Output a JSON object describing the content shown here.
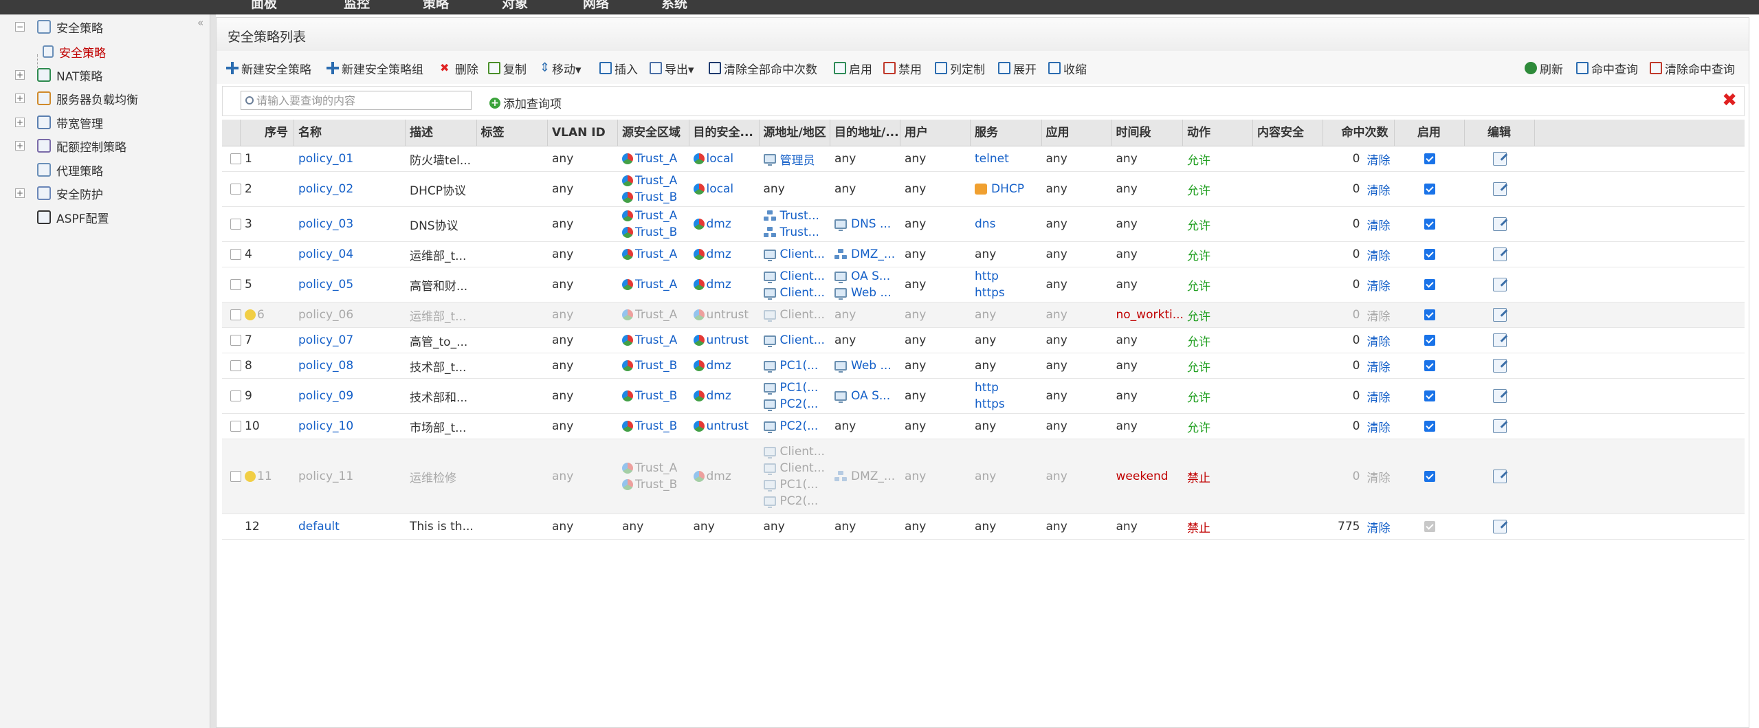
{
  "topnav": {
    "items": [
      "面板",
      "监控",
      "策略",
      "对象",
      "网络",
      "系统"
    ]
  },
  "sidebar": {
    "collapse_icon": "«",
    "items": [
      {
        "label": "安全策略",
        "toggle": "−",
        "icon": "policy-icon"
      },
      {
        "label": "安全策略",
        "selected": true,
        "icon": "policy-icon"
      },
      {
        "label": "NAT策略",
        "toggle": "+",
        "icon": "nat-icon"
      },
      {
        "label": "服务器负载均衡",
        "toggle": "+",
        "icon": "server-lb-icon"
      },
      {
        "label": "带宽管理",
        "toggle": "+",
        "icon": "bandwidth-icon"
      },
      {
        "label": "配额控制策略",
        "toggle": "+",
        "icon": "quota-icon"
      },
      {
        "label": "代理策略",
        "icon": "proxy-icon"
      },
      {
        "label": "安全防护",
        "toggle": "+",
        "icon": "shield-icon"
      },
      {
        "label": "ASPF配置",
        "icon": "aspf-icon"
      }
    ]
  },
  "panel": {
    "title": "安全策略列表"
  },
  "toolbar": {
    "new_policy": "新建安全策略",
    "new_group": "新建安全策略组",
    "delete": "删除",
    "copy": "复制",
    "move": "移动▾",
    "insert": "插入",
    "export": "导出▾",
    "clear_hits": "清除全部命中次数",
    "enable": "启用",
    "disable": "禁用",
    "customize_cols": "列定制",
    "expand": "展开",
    "collapse": "收缩",
    "refresh": "刷新",
    "hit_query": "命中查询",
    "clear_hit_query": "清除命中查询"
  },
  "search": {
    "placeholder": "请输入要查询的内容",
    "add_query": "添加查询项"
  },
  "table": {
    "columns": [
      "序号",
      "名称",
      "描述",
      "标签",
      "VLAN ID",
      "源安全区域",
      "目的安全...",
      "源地址/地区",
      "目的地址/...",
      "用户",
      "服务",
      "应用",
      "时间段",
      "动作",
      "内容安全",
      "命中次数",
      "启用",
      "编辑"
    ],
    "rows": [
      {
        "no": "1",
        "name": "policy_01",
        "desc": "防火墙tel...",
        "vlan": "any",
        "src_zone": [
          "Trust_A"
        ],
        "dst_zone": [
          "local"
        ],
        "src_addr": [
          "管理员"
        ],
        "src_addr_icon": "pc",
        "dst_addr": [
          "any"
        ],
        "dst_addr_icon": "",
        "user": "any",
        "service": [
          "telnet"
        ],
        "service_icon": "",
        "app": "any",
        "time": "any",
        "action": "允许",
        "hits": "0",
        "clear": "清除",
        "enabled": true,
        "disabled_row": false,
        "warn": false
      },
      {
        "no": "2",
        "name": "policy_02",
        "desc": "DHCP协议",
        "vlan": "any",
        "src_zone": [
          "Trust_A",
          "Trust_B"
        ],
        "dst_zone": [
          "local"
        ],
        "src_addr": [
          "any"
        ],
        "src_addr_icon": "",
        "dst_addr": [
          "any"
        ],
        "dst_addr_icon": "",
        "user": "any",
        "service": [
          "DHCP"
        ],
        "service_icon": "dhcp",
        "app": "any",
        "time": "any",
        "action": "允许",
        "hits": "0",
        "clear": "清除",
        "enabled": true,
        "disabled_row": false,
        "warn": false
      },
      {
        "no": "3",
        "name": "policy_03",
        "desc": "DNS协议",
        "vlan": "any",
        "src_zone": [
          "Trust_A",
          "Trust_B"
        ],
        "dst_zone": [
          "dmz"
        ],
        "src_addr": [
          "Trust...",
          "Trust..."
        ],
        "src_addr_icon": "net",
        "dst_addr": [
          "DNS ..."
        ],
        "dst_addr_icon": "pc",
        "user": "any",
        "service": [
          "dns"
        ],
        "service_icon": "",
        "app": "any",
        "time": "any",
        "action": "允许",
        "hits": "0",
        "clear": "清除",
        "enabled": true,
        "disabled_row": false,
        "warn": false
      },
      {
        "no": "4",
        "name": "policy_04",
        "desc": "运维部_t...",
        "vlan": "any",
        "src_zone": [
          "Trust_A"
        ],
        "dst_zone": [
          "dmz"
        ],
        "src_addr": [
          "Client..."
        ],
        "src_addr_icon": "pc",
        "dst_addr": [
          "DMZ_..."
        ],
        "dst_addr_icon": "net",
        "user": "any",
        "service": [
          "any"
        ],
        "service_icon": "",
        "app": "any",
        "time": "any",
        "action": "允许",
        "hits": "0",
        "clear": "清除",
        "enabled": true,
        "disabled_row": false,
        "warn": false
      },
      {
        "no": "5",
        "name": "policy_05",
        "desc": "高管和财...",
        "vlan": "any",
        "src_zone": [
          "Trust_A"
        ],
        "dst_zone": [
          "dmz"
        ],
        "src_addr": [
          "Client...",
          "Client..."
        ],
        "src_addr_icon": "pc",
        "dst_addr": [
          "OA S...",
          "Web ..."
        ],
        "dst_addr_icon": "pc",
        "user": "any",
        "service": [
          "http",
          "https"
        ],
        "service_icon": "",
        "app": "any",
        "time": "any",
        "action": "允许",
        "hits": "0",
        "clear": "清除",
        "enabled": true,
        "disabled_row": false,
        "warn": false
      },
      {
        "no": "6",
        "name": "policy_06",
        "desc": "运维部_t...",
        "vlan": "any",
        "src_zone": [
          "Trust_A"
        ],
        "dst_zone": [
          "untrust"
        ],
        "src_addr": [
          "Client..."
        ],
        "src_addr_icon": "pc",
        "dst_addr": [
          "any"
        ],
        "dst_addr_icon": "",
        "user": "any",
        "service": [
          "any"
        ],
        "service_icon": "",
        "app": "any",
        "time": "no_workti...",
        "action": "允许",
        "hits": "0",
        "clear": "清除",
        "enabled": true,
        "disabled_row": true,
        "warn": true
      },
      {
        "no": "7",
        "name": "policy_07",
        "desc": "高管_to_...",
        "vlan": "any",
        "src_zone": [
          "Trust_A"
        ],
        "dst_zone": [
          "untrust"
        ],
        "src_addr": [
          "Client..."
        ],
        "src_addr_icon": "pc",
        "dst_addr": [
          "any"
        ],
        "dst_addr_icon": "",
        "user": "any",
        "service": [
          "any"
        ],
        "service_icon": "",
        "app": "any",
        "time": "any",
        "action": "允许",
        "hits": "0",
        "clear": "清除",
        "enabled": true,
        "disabled_row": false,
        "warn": false
      },
      {
        "no": "8",
        "name": "policy_08",
        "desc": "技术部_t...",
        "vlan": "any",
        "src_zone": [
          "Trust_B"
        ],
        "dst_zone": [
          "dmz"
        ],
        "src_addr": [
          "PC1(..."
        ],
        "src_addr_icon": "pc",
        "dst_addr": [
          "Web ..."
        ],
        "dst_addr_icon": "pc",
        "user": "any",
        "service": [
          "any"
        ],
        "service_icon": "",
        "app": "any",
        "time": "any",
        "action": "允许",
        "hits": "0",
        "clear": "清除",
        "enabled": true,
        "disabled_row": false,
        "warn": false
      },
      {
        "no": "9",
        "name": "policy_09",
        "desc": "技术部和...",
        "vlan": "any",
        "src_zone": [
          "Trust_B"
        ],
        "dst_zone": [
          "dmz"
        ],
        "src_addr": [
          "PC1(...",
          "PC2(..."
        ],
        "src_addr_icon": "pc",
        "dst_addr": [
          "OA S..."
        ],
        "dst_addr_icon": "pc",
        "user": "any",
        "service": [
          "http",
          "https"
        ],
        "service_icon": "",
        "app": "any",
        "time": "any",
        "action": "允许",
        "hits": "0",
        "clear": "清除",
        "enabled": true,
        "disabled_row": false,
        "warn": false
      },
      {
        "no": "10",
        "name": "policy_10",
        "desc": "市场部_t...",
        "vlan": "any",
        "src_zone": [
          "Trust_B"
        ],
        "dst_zone": [
          "untrust"
        ],
        "src_addr": [
          "PC2(..."
        ],
        "src_addr_icon": "pc",
        "dst_addr": [
          "any"
        ],
        "dst_addr_icon": "",
        "user": "any",
        "service": [
          "any"
        ],
        "service_icon": "",
        "app": "any",
        "time": "any",
        "action": "允许",
        "hits": "0",
        "clear": "清除",
        "enabled": true,
        "disabled_row": false,
        "warn": false
      },
      {
        "no": "11",
        "name": "policy_11",
        "desc": "运维检修",
        "vlan": "any",
        "src_zone": [
          "Trust_A",
          "Trust_B"
        ],
        "dst_zone": [
          "dmz"
        ],
        "src_addr": [
          "Client...",
          "Client...",
          "PC1(...",
          "PC2(..."
        ],
        "src_addr_icon": "pc",
        "dst_addr": [
          "DMZ_..."
        ],
        "dst_addr_icon": "net",
        "user": "any",
        "service": [
          "any"
        ],
        "service_icon": "",
        "app": "any",
        "time": "weekend",
        "action": "禁止",
        "hits": "0",
        "clear": "清除",
        "enabled": true,
        "disabled_row": true,
        "warn": true
      },
      {
        "no": "12",
        "name": "default",
        "desc": "This is th...",
        "vlan": "any",
        "src_zone_plain": "any",
        "dst_zone_plain": "any",
        "src_addr": [
          "any"
        ],
        "src_addr_icon": "",
        "dst_addr": [
          "any"
        ],
        "dst_addr_icon": "",
        "user": "any",
        "service": [
          "any"
        ],
        "service_icon": "",
        "app": "any",
        "time": "any",
        "action": "禁止",
        "hits": "775",
        "clear": "清除",
        "enabled": true,
        "enabled_locked": true,
        "disabled_row": false,
        "warn": false,
        "no_checkbox": true
      }
    ]
  }
}
